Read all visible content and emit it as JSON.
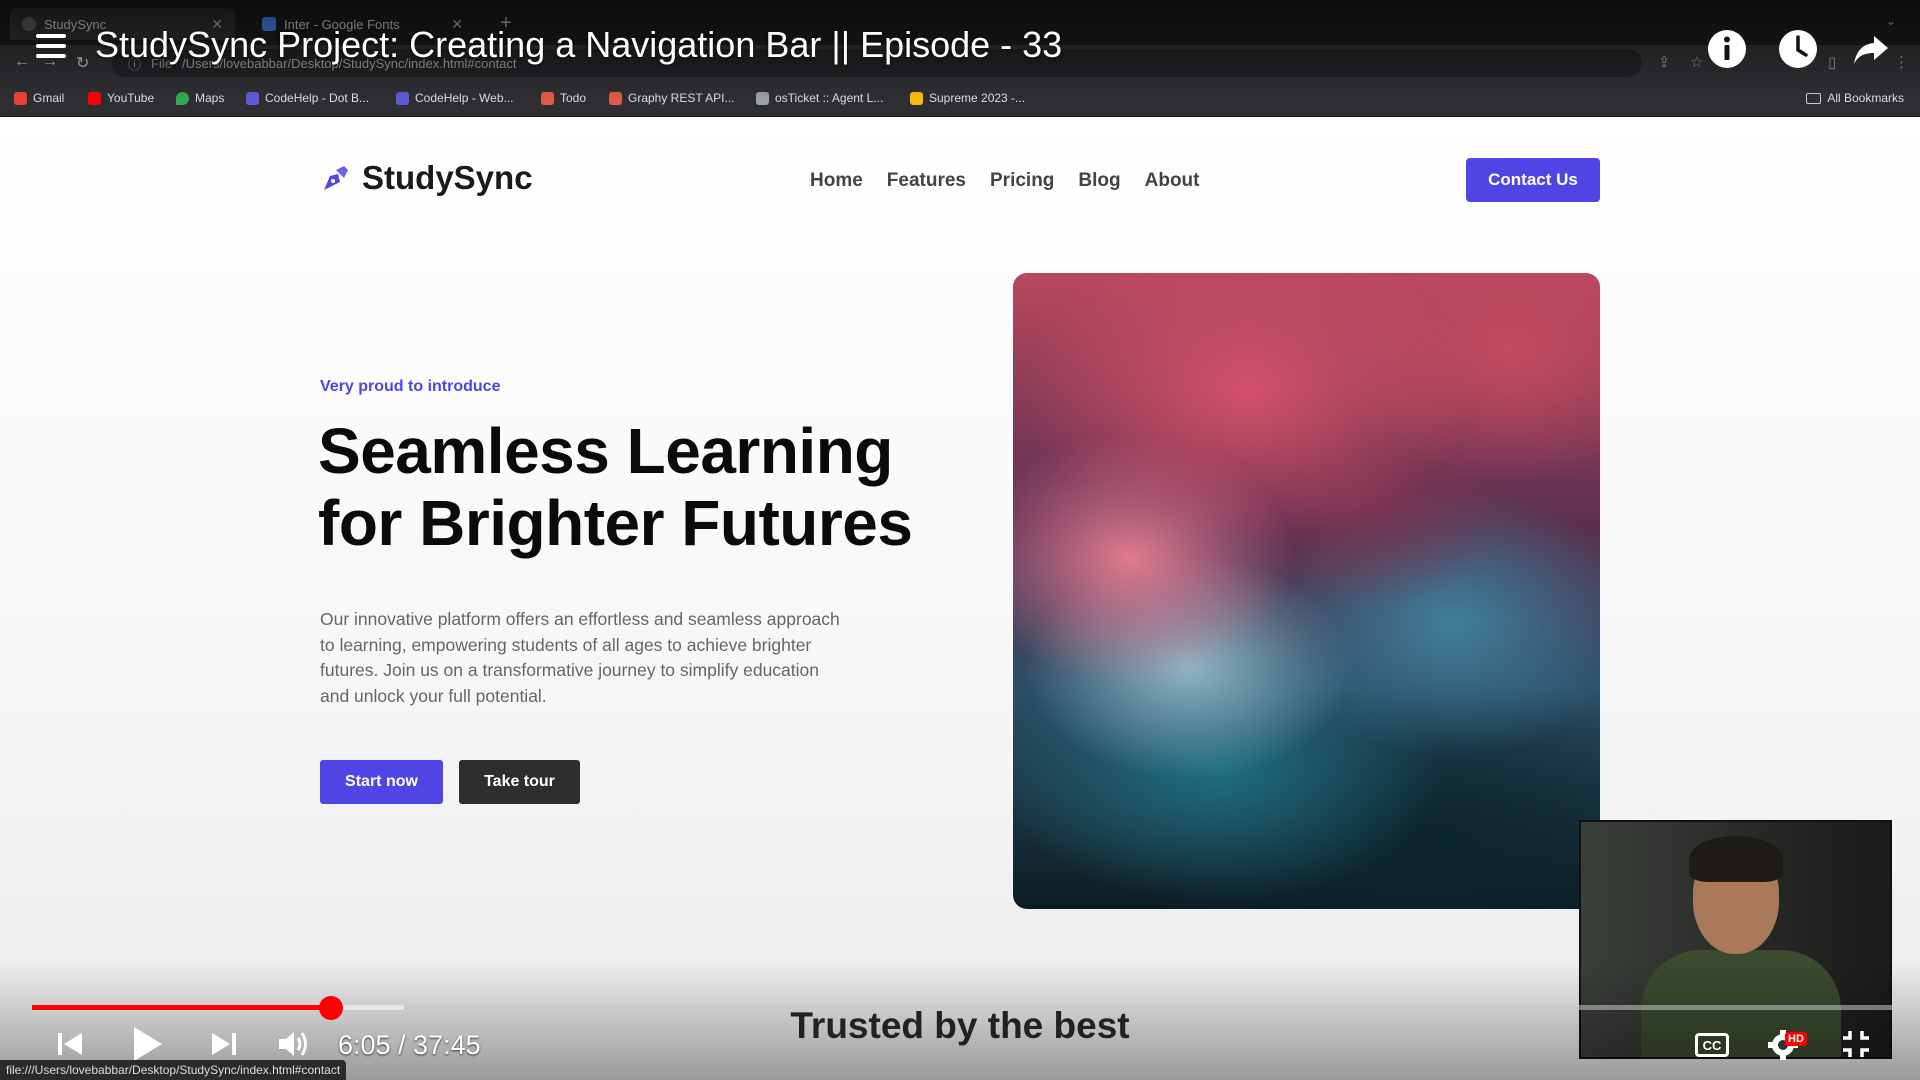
{
  "browser": {
    "tabs": [
      {
        "title": "StudySync",
        "active": true
      },
      {
        "title": "Inter - Google Fonts",
        "active": false
      }
    ],
    "url_scheme_label": "File",
    "url": "/Users/lovebabbar/Desktop/StudySync/index.html#contact",
    "bookmarks": [
      {
        "label": "Gmail",
        "color": "#ea4335"
      },
      {
        "label": "YouTube",
        "color": "#ff0000"
      },
      {
        "label": "Maps",
        "color": "#34a853"
      },
      {
        "label": "CodeHelp - Dot B...",
        "color": "#5b5bd6"
      },
      {
        "label": "CodeHelp - Web...",
        "color": "#5b5bd6"
      },
      {
        "label": "Todo",
        "color": "#e05a47"
      },
      {
        "label": "Graphy REST API...",
        "color": "#e05a47"
      },
      {
        "label": "osTicket :: Agent L...",
        "color": "#9aa0a6"
      },
      {
        "label": "Supreme 2023 -...",
        "color": "#fbbc04"
      }
    ],
    "all_bookmarks": "All Bookmarks",
    "status_url": "file:///Users/lovebabbar/Desktop/StudySync/index.html#contact"
  },
  "video": {
    "title": "StudySync Project: Creating a Navigation Bar || Episode - 33",
    "current_time": "6:05",
    "duration": "37:45",
    "timecode": "6:05 / 37:45",
    "progress_fraction": 0.161,
    "buffered_fraction": 0.2,
    "cc_label": "CC",
    "hd_label": "HD"
  },
  "site": {
    "brand": "StudySync",
    "nav": [
      "Home",
      "Features",
      "Pricing",
      "Blog",
      "About"
    ],
    "contact_button": "Contact Us",
    "eyebrow": "Very proud to introduce",
    "headline_line1": "Seamless Learning",
    "headline_line2": "for Brighter Futures",
    "body": "Our innovative platform offers an effortless and seamless approach to learning, empowering students of all ages to achieve brighter futures. Join us on a transformative journey to simplify education and unlock your full potential.",
    "start_button": "Start now",
    "tour_button": "Take tour",
    "trusted_heading": "Trusted by the best"
  },
  "colors": {
    "accent": "#4f46e5",
    "progress": "#ff0000",
    "dark_button": "#2e2e2e"
  }
}
